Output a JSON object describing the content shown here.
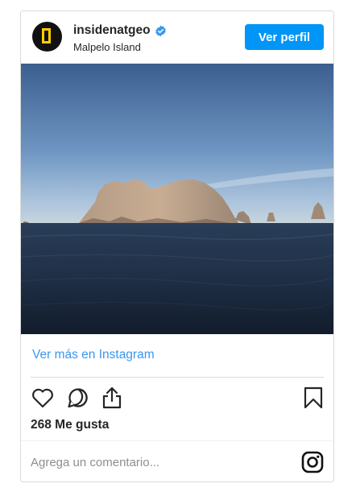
{
  "post": {
    "username": "insidenatgeo",
    "location": "Malpelo Island",
    "profile_button": "Ver perfil",
    "view_more": "Ver más en Instagram",
    "likes": "268 Me gusta",
    "comment_placeholder": "Agrega un comentario..."
  },
  "colors": {
    "accent": "#0095f6",
    "link": "#3897f0",
    "logo_yellow": "#ffce00"
  },
  "icons": [
    "verified-badge-icon",
    "heart-icon",
    "comment-icon",
    "share-icon",
    "bookmark-icon",
    "instagram-icon"
  ]
}
